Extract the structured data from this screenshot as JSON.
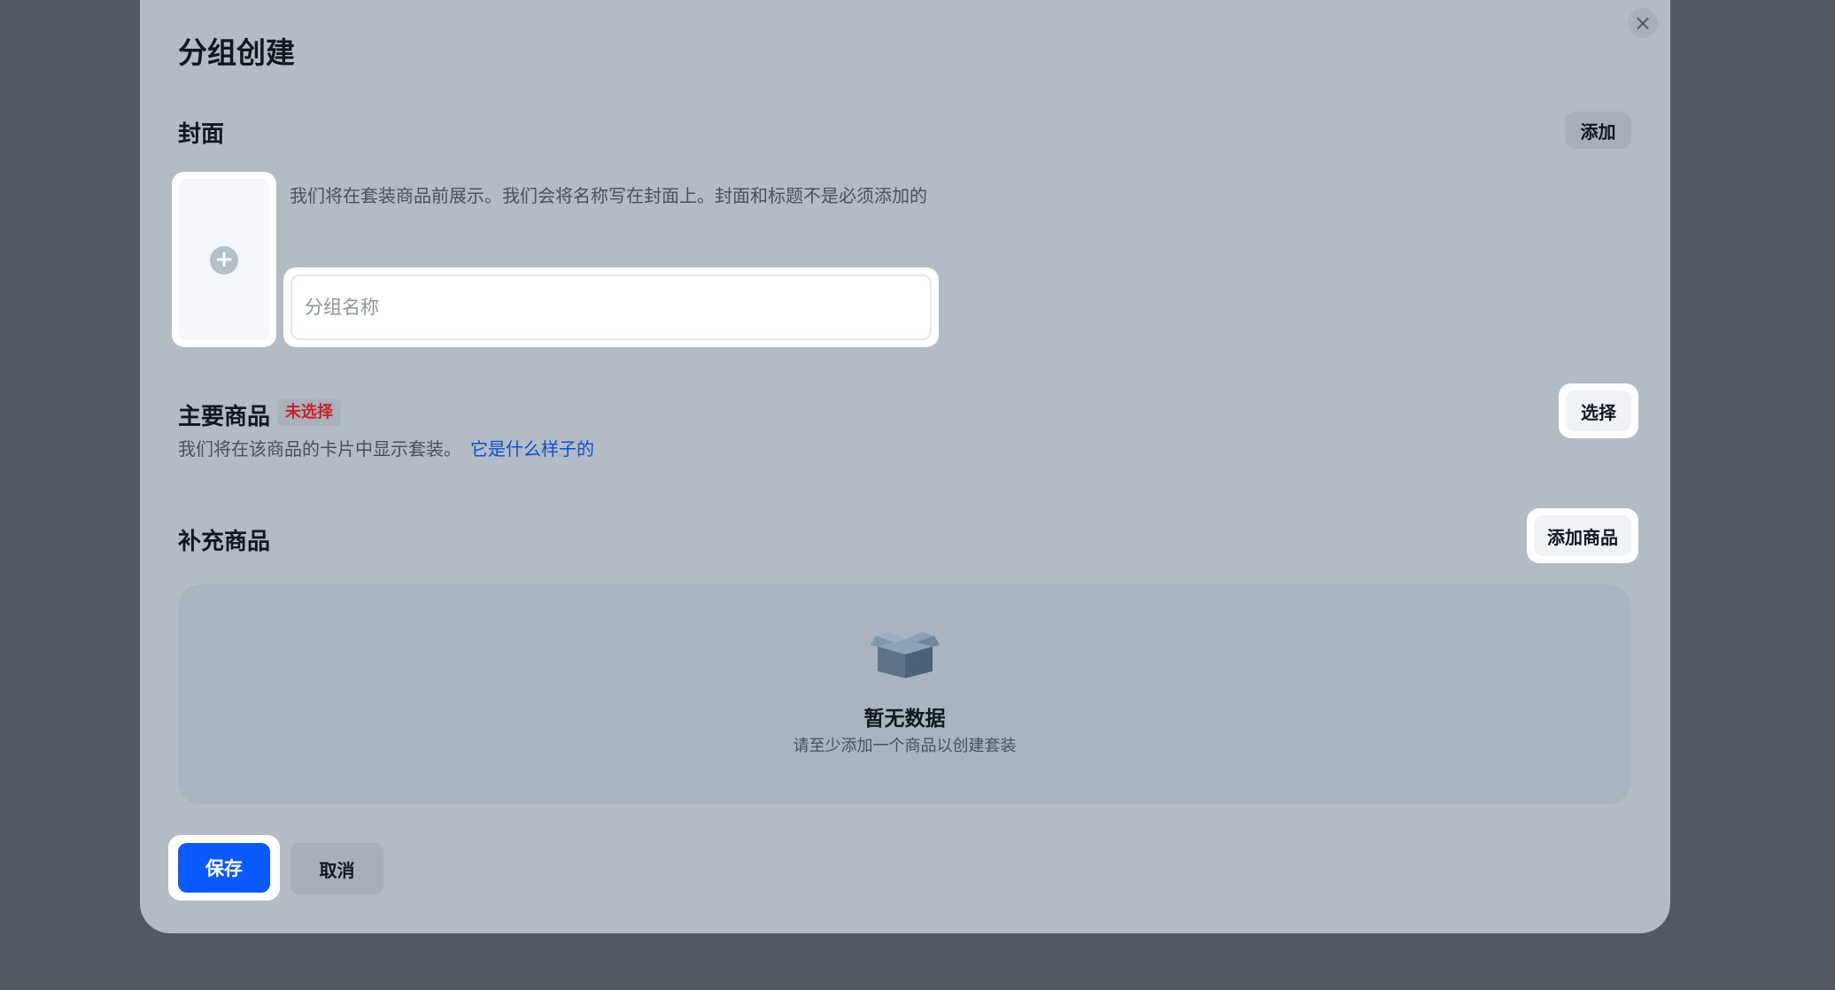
{
  "dialog": {
    "title": "分组创建",
    "close_symbol": "×"
  },
  "cover": {
    "section_title": "封面",
    "add_label": "添加",
    "description": "我们将在套装商品前展示。我们会将名称写在封面上。封面和标题不是必须添加的",
    "name_placeholder": "分组名称",
    "name_value": "",
    "upload_icon": "plus-icon"
  },
  "main_product": {
    "section_title": "主要商品",
    "badge": "未选择",
    "description": "我们将在该商品的卡片中显示套装。",
    "link_text": "它是什么样子的",
    "select_label": "选择"
  },
  "supplementary": {
    "section_title": "补充商品",
    "add_product_label": "添加商品",
    "empty_icon": "open-box-icon",
    "empty_title": "暂无数据",
    "empty_subtitle": "请至少添加一个商品以创建套装"
  },
  "footer": {
    "save_label": "保存",
    "cancel_label": "取消"
  },
  "colors": {
    "overlay": "#515a63",
    "modal": "#b3bbc4",
    "primary": "#0a5bff",
    "badge_text": "#c8222a",
    "link": "#0f4fd6"
  }
}
